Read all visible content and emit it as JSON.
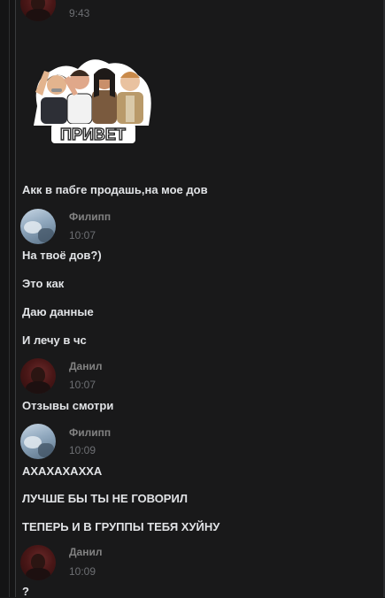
{
  "messages": [
    {
      "author": "",
      "time": "9:43"
    },
    {
      "text": "Акк в пабге продашь,на мое дов"
    },
    {
      "author": "Филипп",
      "time": "10:07",
      "lines": [
        "На твоё дов?)",
        "Это как",
        "Даю данные",
        "И лечу в чс"
      ]
    },
    {
      "author": "Данил",
      "time": "10:07",
      "lines": [
        "Отзывы смотри"
      ]
    },
    {
      "author": "Филипп",
      "time": "10:09",
      "lines": [
        "АХАХАХАХХА",
        "ЛУЧШЕ БЫ ТЫ НЕ ГОВОРИЛ",
        "ТЕПЕРЬ И В ГРУППЫ ТЕБЯ ХУЙНУ"
      ]
    },
    {
      "author": "Данил",
      "time": "10:09",
      "lines": [
        "?"
      ]
    }
  ],
  "sticker": {
    "caption": "ПРИВЕТ",
    "icon": "group-wave-sticker"
  },
  "colors": {
    "background": "#19191a",
    "text": "#e1e3e6",
    "name": "#828282",
    "time": "#6d6f73"
  }
}
